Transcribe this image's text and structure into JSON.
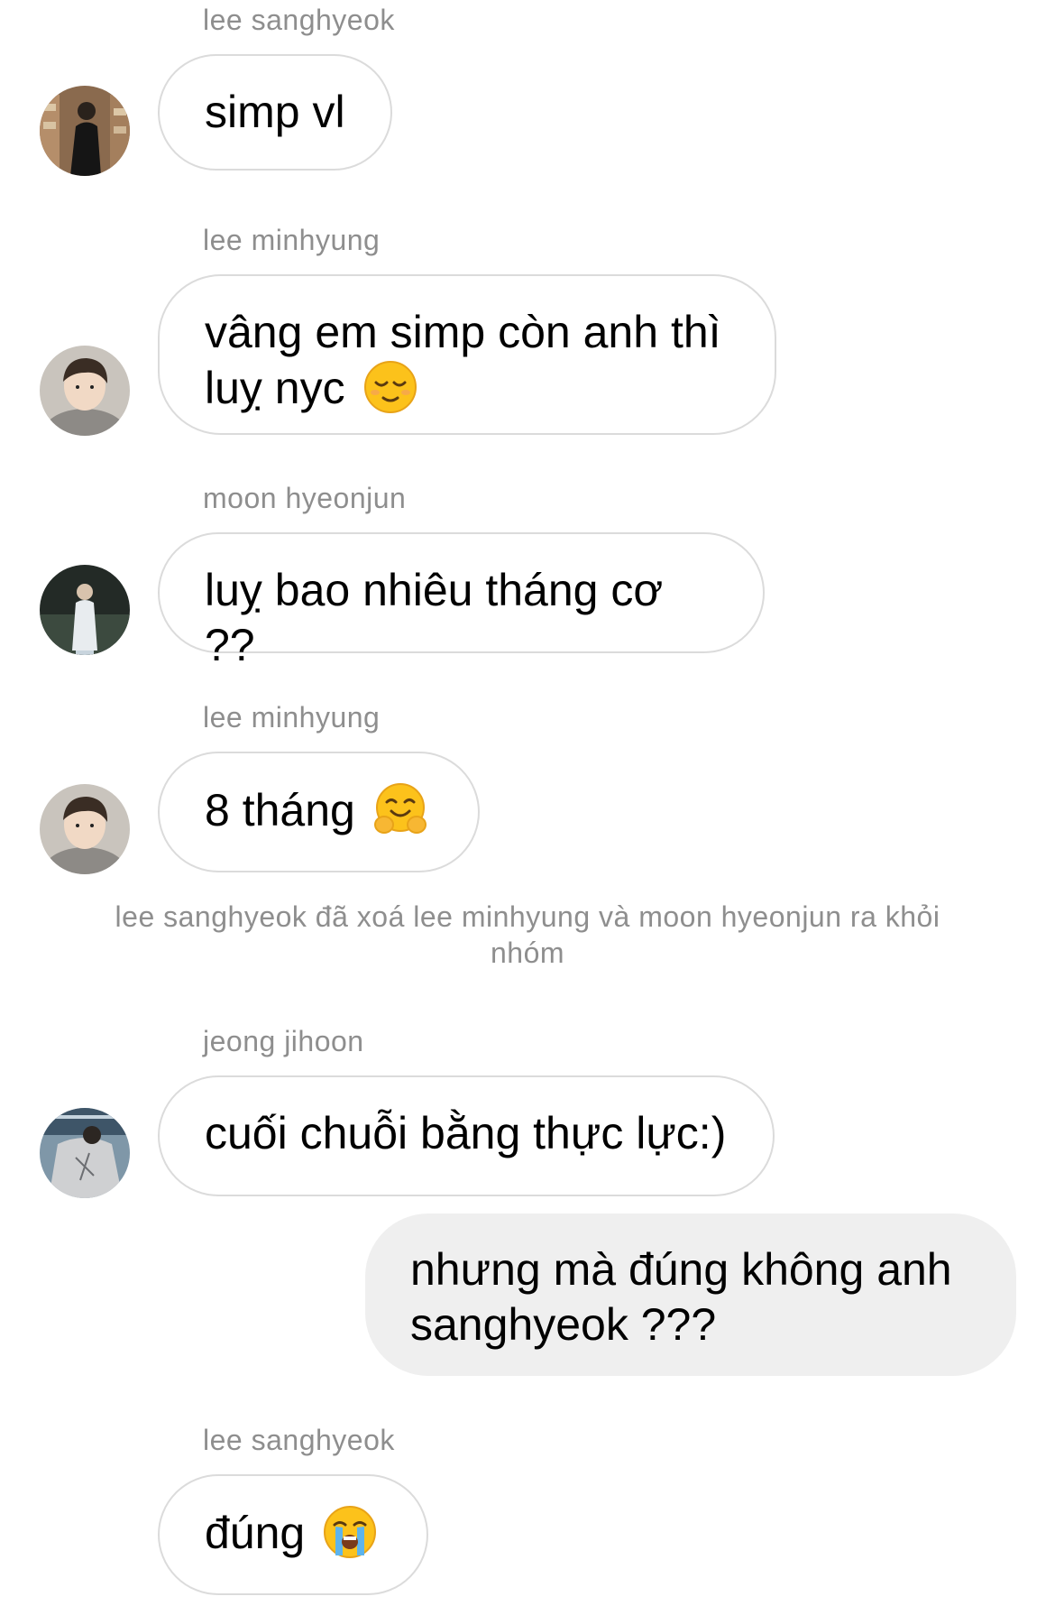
{
  "messages": [
    {
      "sender": "lee sanghyeok",
      "text": "simp vl"
    },
    {
      "sender": "lee minhyung",
      "text": "vâng em simp còn anh thì luỵ nyc",
      "emoji": "relieved-face"
    },
    {
      "sender": "moon hyeonjun",
      "text": "luỵ bao nhiêu tháng cơ ??"
    },
    {
      "sender": "lee minhyung",
      "text": "8 tháng",
      "emoji": "hugging-face"
    },
    {
      "sender": "jeong jihoon",
      "text": "cuối chuỗi bằng thực lực:)"
    },
    {
      "text": "nhưng mà đúng không anh sanghyeok ???"
    },
    {
      "sender": "lee sanghyeok",
      "text": "đúng",
      "emoji": "loudly-crying-face"
    }
  ],
  "system_notice": "lee sanghyeok đã xoá lee minhyung và moon hyeonjun ra khỏi nhóm",
  "colors": {
    "meta_text": "#8e8e8e",
    "bubble_border": "#dbdbdb",
    "outgoing_bubble": "#efefef"
  }
}
